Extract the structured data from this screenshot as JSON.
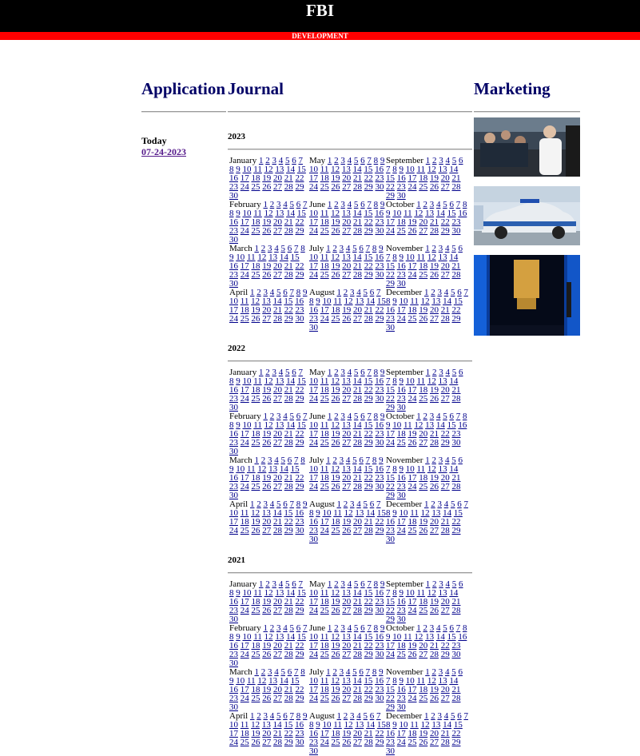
{
  "header": {
    "title": "FBI",
    "subtitle": "DEVELOPMENT"
  },
  "application": {
    "heading": "Application",
    "today_label": "Today",
    "today_date": "07-24-2023"
  },
  "journal": {
    "heading": "Journal",
    "years": [
      {
        "year": "2023",
        "months": [
          "January",
          "May",
          "September",
          "February",
          "June",
          "October",
          "March",
          "July",
          "November",
          "April",
          "August",
          "December"
        ]
      },
      {
        "year": "2022",
        "months": [
          "January",
          "May",
          "September",
          "February",
          "June",
          "October",
          "March",
          "July",
          "November",
          "April",
          "August",
          "December"
        ]
      },
      {
        "year": "2021",
        "months": [
          "January",
          "May",
          "September",
          "February",
          "June",
          "October",
          "March",
          "July",
          "November",
          "April",
          "August",
          "December"
        ]
      }
    ],
    "days": [
      "1",
      "2",
      "3",
      "4",
      "5",
      "6",
      "7",
      "8",
      "9",
      "10",
      "11",
      "12",
      "13",
      "14",
      "15",
      "16",
      "17",
      "18",
      "19",
      "20",
      "21",
      "22",
      "23",
      "24",
      "25",
      "26",
      "27",
      "28",
      "29",
      "30"
    ]
  },
  "marketing": {
    "heading": "Marketing",
    "images": [
      {
        "name": "crowd-photo",
        "colors": [
          "#2b3a4a",
          "#f2f2f2",
          "#8a6a50"
        ]
      },
      {
        "name": "police-car-photo",
        "colors": [
          "#d8e2ec",
          "#2a5fb0",
          "#9aa6b0"
        ]
      },
      {
        "name": "blue-room-photo",
        "colors": [
          "#0a3c9a",
          "#d4a040",
          "#000000"
        ]
      }
    ]
  }
}
